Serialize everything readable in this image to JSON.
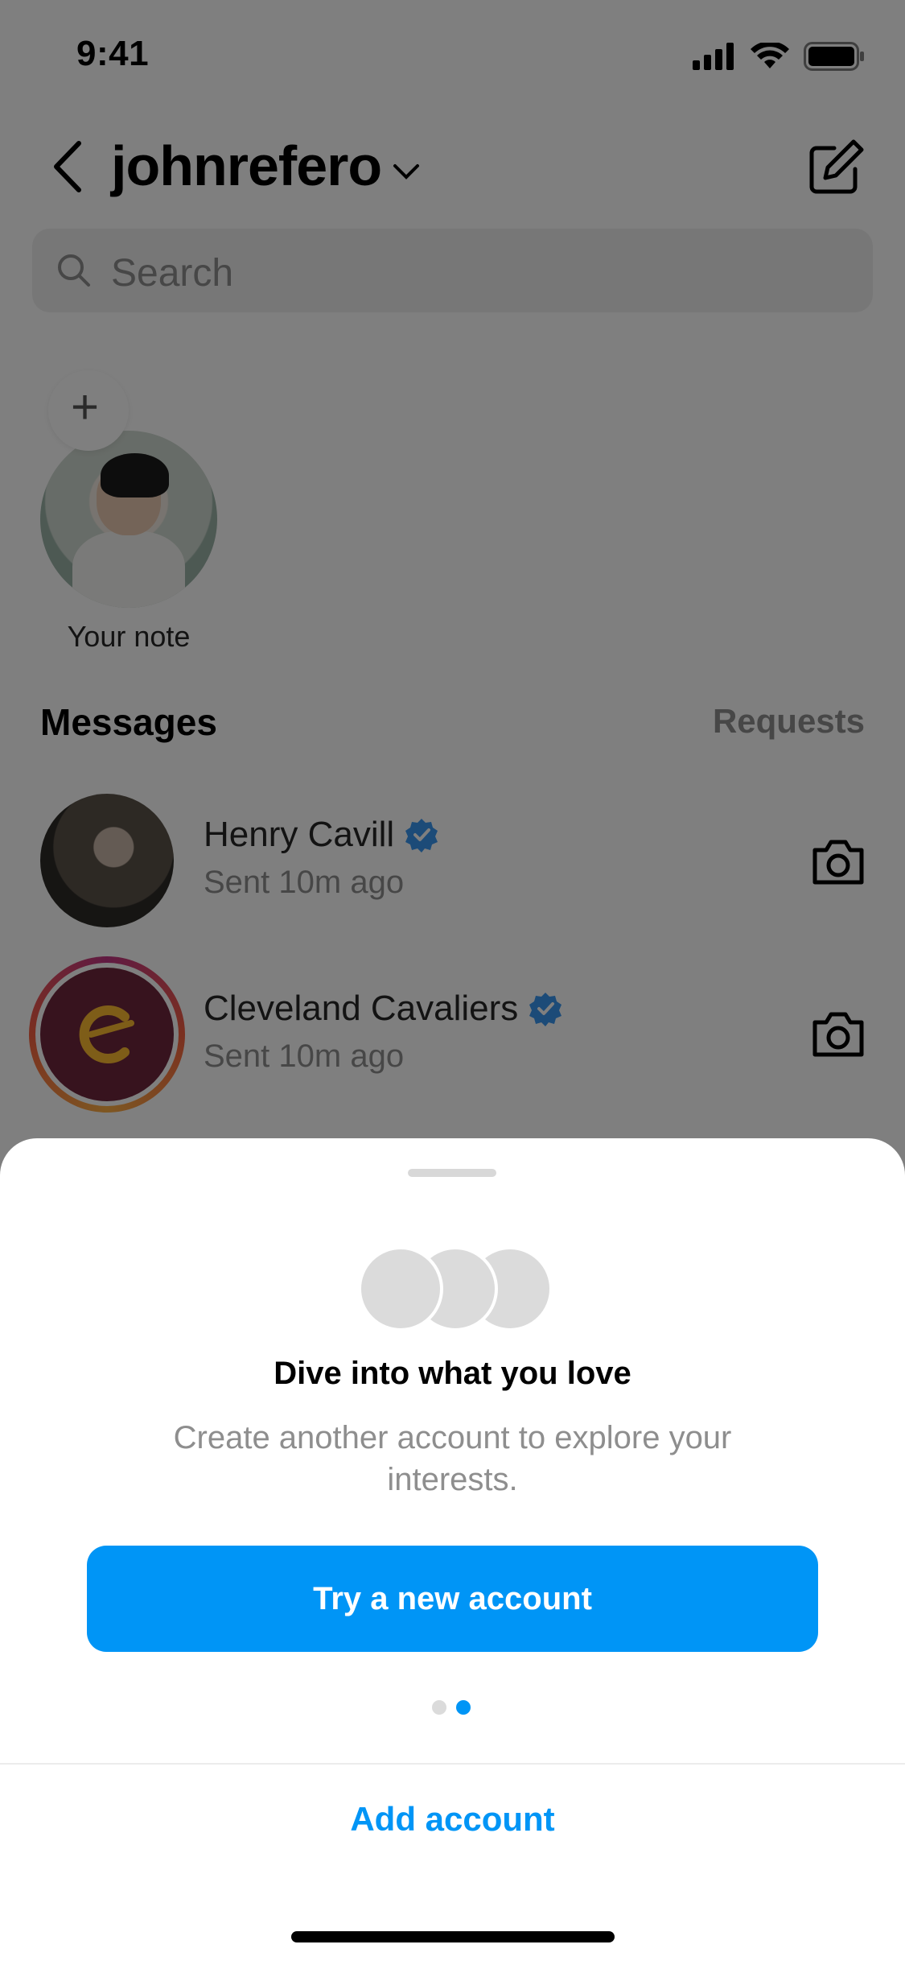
{
  "status_bar": {
    "time": "9:41"
  },
  "header": {
    "username": "johnrefero"
  },
  "search": {
    "placeholder": "Search"
  },
  "note": {
    "label": "Your note"
  },
  "messages": {
    "title": "Messages",
    "requests": "Requests",
    "threads": [
      {
        "name": "Henry Cavill",
        "status": "Sent 10m ago",
        "verified": true
      },
      {
        "name": "Cleveland Cavaliers",
        "status": "Sent 10m ago",
        "verified": true
      }
    ]
  },
  "sheet": {
    "title": "Dive into what you love",
    "subtitle": "Create another account to explore your interests.",
    "primary_button": "Try a new account",
    "page_count": 2,
    "active_page": 2,
    "secondary_button": "Add account"
  },
  "colors": {
    "accent": "#0095f6",
    "verified": "#3897f0",
    "cavaliers": "#6f263d"
  }
}
